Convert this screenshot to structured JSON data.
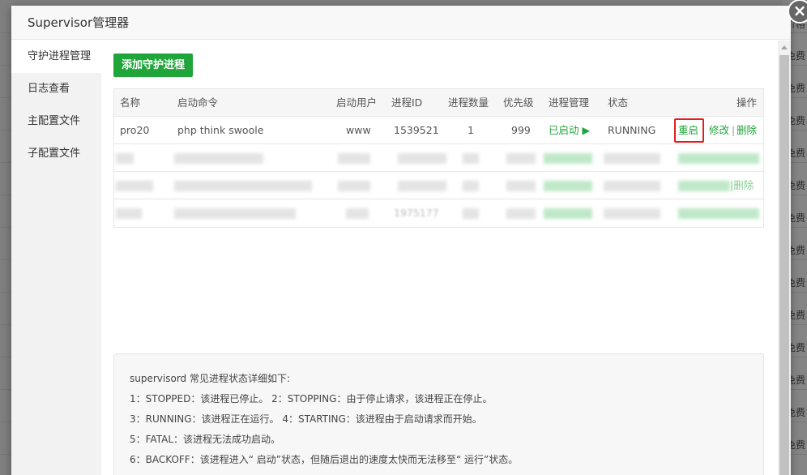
{
  "background": {
    "cells": [
      {
        "text": "价格"
      },
      {
        "text": "免费"
      },
      {
        "text": "免费"
      },
      {
        "text": "免费"
      },
      {
        "text": "免费"
      },
      {
        "text": "免费"
      },
      {
        "text": "免费"
      },
      {
        "text": "免费"
      },
      {
        "text": "免费"
      },
      {
        "text": "免费"
      },
      {
        "text": "免费"
      },
      {
        "text": "免费"
      },
      {
        "text": "免费"
      },
      {
        "text": "免费"
      }
    ]
  },
  "modal": {
    "title": "Supervisor管理器",
    "close_icon": "×"
  },
  "sidebar": {
    "items": [
      {
        "label": "守护进程管理"
      },
      {
        "label": "日志查看"
      },
      {
        "label": "主配置文件"
      },
      {
        "label": "子配置文件"
      }
    ]
  },
  "toolbar": {
    "add_label": "添加守护进程"
  },
  "table": {
    "headers": {
      "name": "名称",
      "command": "启动命令",
      "user": "启动用户",
      "pid": "进程ID",
      "count": "进程数量",
      "priority": "优先级",
      "manage": "进程管理",
      "status": "状态",
      "actions": "操作"
    },
    "row1": {
      "name": "pro20",
      "command": "php think swoole",
      "user": "www",
      "pid": "1539521",
      "count": "1",
      "priority": "999",
      "manage": "已启动",
      "manage_icon": "▶",
      "status": "RUNNING",
      "restart": "重启",
      "edit": "修改",
      "sep": "|",
      "delete": "删除"
    },
    "row3_partial": "|删除",
    "row4_pid_partial": "1975177"
  },
  "info": {
    "lines": [
      "supervisord 常见进程状态详细如下:",
      "1：STOPPED：该进程已停止。     2：STOPPING：由于停止请求，该进程正在停止。",
      "3：RUNNING：该进程正在运行。  4：STARTING：该进程由于启动请求而开始。",
      "5：FATAL：该进程无法成功启动。",
      "6：BACKOFF：该进程进入“ 启动”状态，但随后退出的速度太快而无法移至“ 运行”状态。"
    ]
  },
  "colors": {
    "accent": "#20a53a",
    "highlight_border": "#e02020"
  }
}
